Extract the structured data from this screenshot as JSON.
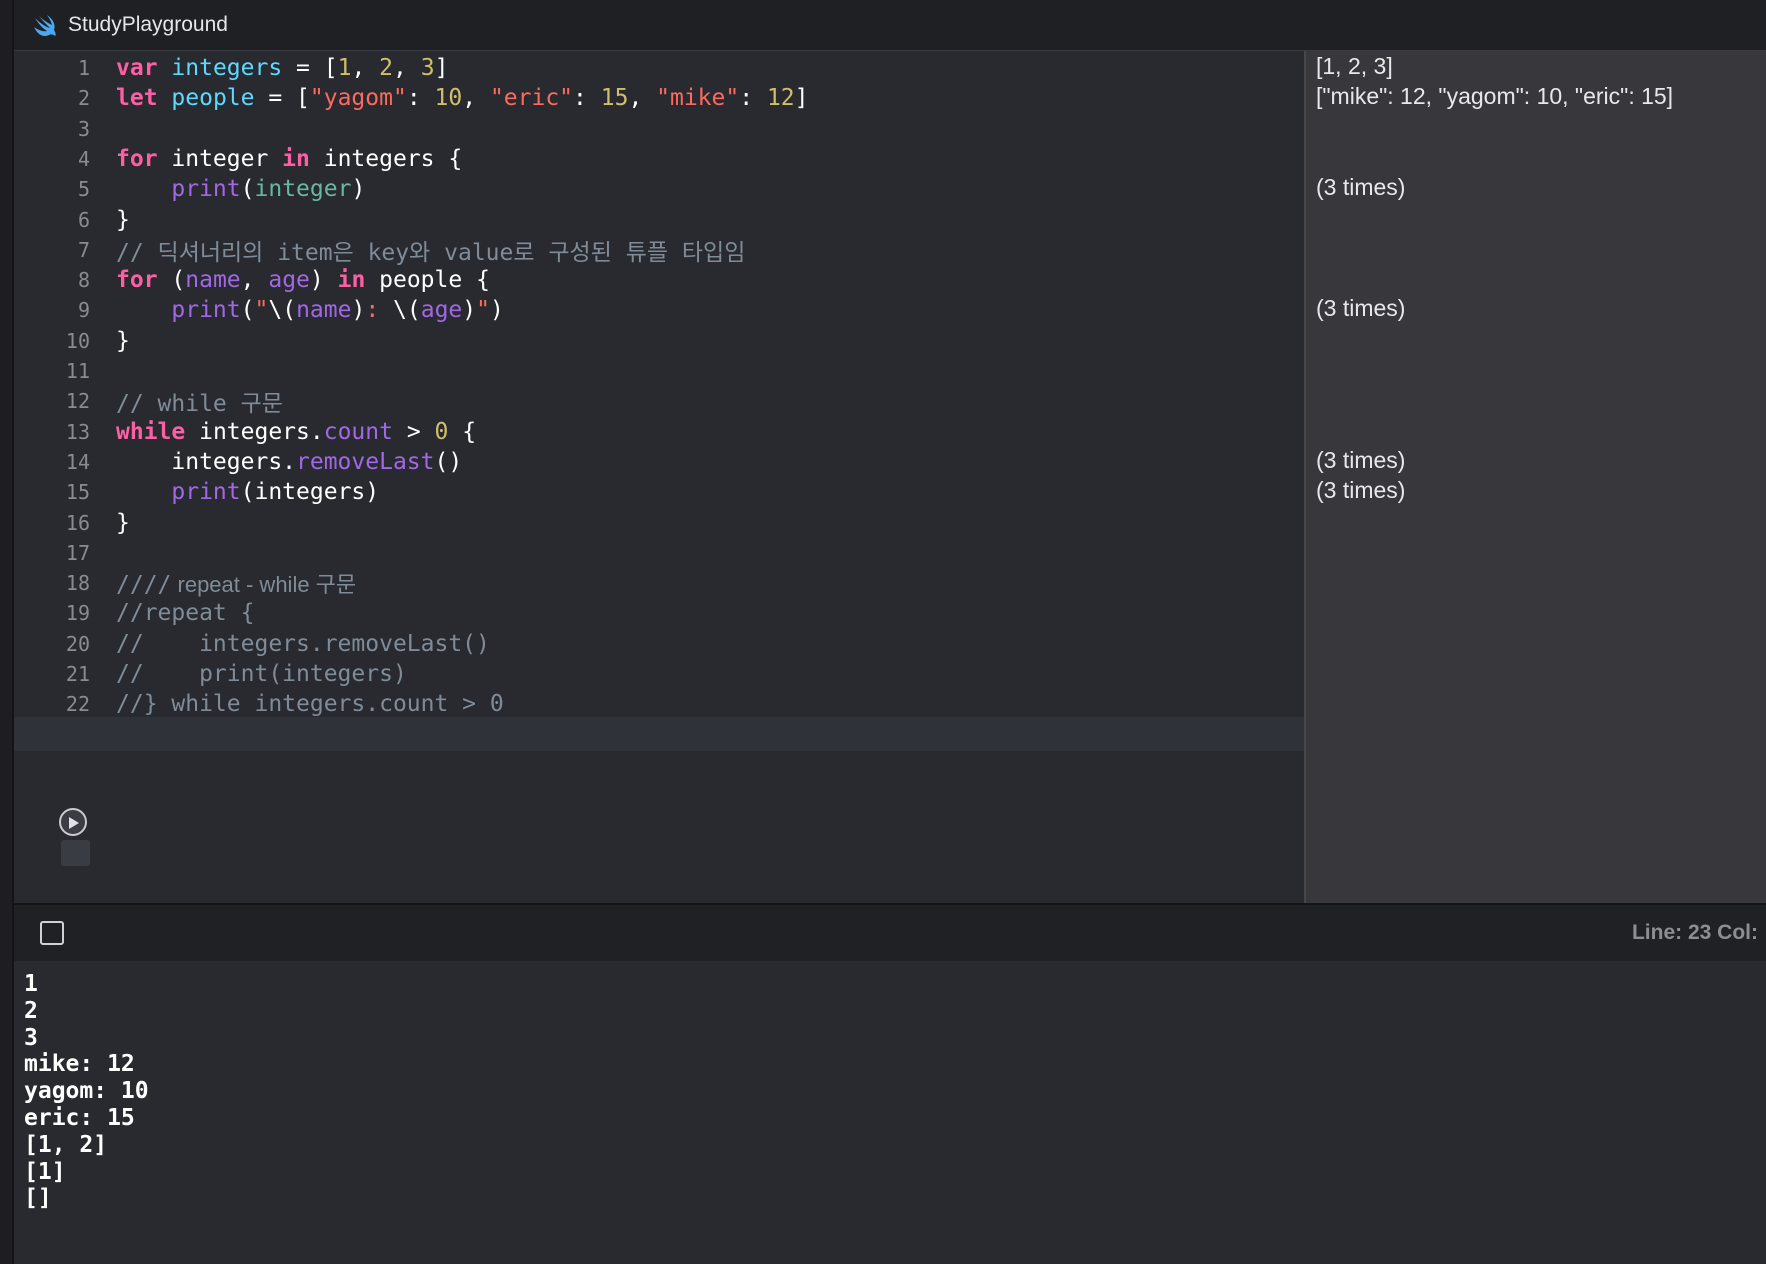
{
  "window": {
    "title": "StudyPlayground"
  },
  "editor": {
    "line_numbers": [
      "1",
      "2",
      "3",
      "4",
      "5",
      "6",
      "7",
      "8",
      "9",
      "10",
      "11",
      "12",
      "13",
      "14",
      "15",
      "16",
      "17",
      "18",
      "19",
      "20",
      "21",
      "22"
    ],
    "lines": [
      [
        {
          "t": "kw",
          "v": "var"
        },
        {
          "t": "p",
          "v": " "
        },
        {
          "t": "var",
          "v": "integers"
        },
        {
          "t": "p",
          "v": " = ["
        },
        {
          "t": "num",
          "v": "1"
        },
        {
          "t": "p",
          "v": ", "
        },
        {
          "t": "num",
          "v": "2"
        },
        {
          "t": "p",
          "v": ", "
        },
        {
          "t": "num",
          "v": "3"
        },
        {
          "t": "p",
          "v": "]"
        }
      ],
      [
        {
          "t": "kw",
          "v": "let"
        },
        {
          "t": "p",
          "v": " "
        },
        {
          "t": "var",
          "v": "people"
        },
        {
          "t": "p",
          "v": " = ["
        },
        {
          "t": "str",
          "v": "\"yagom\""
        },
        {
          "t": "p",
          "v": ": "
        },
        {
          "t": "num",
          "v": "10"
        },
        {
          "t": "p",
          "v": ", "
        },
        {
          "t": "str",
          "v": "\"eric\""
        },
        {
          "t": "p",
          "v": ": "
        },
        {
          "t": "num",
          "v": "15"
        },
        {
          "t": "p",
          "v": ", "
        },
        {
          "t": "str",
          "v": "\"mike\""
        },
        {
          "t": "p",
          "v": ": "
        },
        {
          "t": "num",
          "v": "12"
        },
        {
          "t": "p",
          "v": "]"
        }
      ],
      [],
      [
        {
          "t": "kw",
          "v": "for"
        },
        {
          "t": "p",
          "v": " integer "
        },
        {
          "t": "kw",
          "v": "in"
        },
        {
          "t": "p",
          "v": " integers {"
        }
      ],
      [
        {
          "t": "p",
          "v": "    "
        },
        {
          "t": "fn",
          "v": "print"
        },
        {
          "t": "p",
          "v": "("
        },
        {
          "t": "ident",
          "v": "integer"
        },
        {
          "t": "p",
          "v": ")"
        }
      ],
      [
        {
          "t": "p",
          "v": "}"
        }
      ],
      [
        {
          "t": "cm",
          "v": "// 딕셔너리의 item은 key와 value로 구성된 튜플 타입임"
        }
      ],
      [
        {
          "t": "kw",
          "v": "for"
        },
        {
          "t": "p",
          "v": " ("
        },
        {
          "t": "fn",
          "v": "name"
        },
        {
          "t": "p",
          "v": ", "
        },
        {
          "t": "fn",
          "v": "age"
        },
        {
          "t": "p",
          "v": ") "
        },
        {
          "t": "kw",
          "v": "in"
        },
        {
          "t": "p",
          "v": " people {"
        }
      ],
      [
        {
          "t": "p",
          "v": "    "
        },
        {
          "t": "fn",
          "v": "print"
        },
        {
          "t": "p",
          "v": "("
        },
        {
          "t": "str",
          "v": "\""
        },
        {
          "t": "p",
          "v": "\\("
        },
        {
          "t": "fn",
          "v": "name"
        },
        {
          "t": "p",
          "v": ")"
        },
        {
          "t": "str",
          "v": ": "
        },
        {
          "t": "p",
          "v": "\\("
        },
        {
          "t": "fn",
          "v": "age"
        },
        {
          "t": "p",
          "v": ")"
        },
        {
          "t": "str",
          "v": "\""
        },
        {
          "t": "p",
          "v": ")"
        }
      ],
      [
        {
          "t": "p",
          "v": "}"
        }
      ],
      [],
      [
        {
          "t": "cm",
          "v": "// while 구문"
        }
      ],
      [
        {
          "t": "kw",
          "v": "while"
        },
        {
          "t": "p",
          "v": " integers."
        },
        {
          "t": "prop",
          "v": "count"
        },
        {
          "t": "p",
          "v": " > "
        },
        {
          "t": "num",
          "v": "0"
        },
        {
          "t": "p",
          "v": " {"
        }
      ],
      [
        {
          "t": "p",
          "v": "    integers."
        },
        {
          "t": "fn",
          "v": "removeLast"
        },
        {
          "t": "p",
          "v": "()"
        }
      ],
      [
        {
          "t": "p",
          "v": "    "
        },
        {
          "t": "fn",
          "v": "print"
        },
        {
          "t": "p",
          "v": "(integers)"
        }
      ],
      [
        {
          "t": "p",
          "v": "}"
        }
      ],
      [],
      [
        {
          "t": "cm",
          "v": "////"
        },
        {
          "t": "cm-prop",
          "v": " repeat - while 구문"
        }
      ],
      [
        {
          "t": "cm",
          "v": "//repeat {"
        }
      ],
      [
        {
          "t": "cm",
          "v": "//    integers.removeLast()"
        }
      ],
      [
        {
          "t": "cm",
          "v": "//    print(integers)"
        }
      ],
      [
        {
          "t": "cm",
          "v": "//} while integers.count > 0"
        }
      ]
    ]
  },
  "results": [
    {
      "line": 1,
      "text": "[1, 2, 3]"
    },
    {
      "line": 2,
      "text": "[\"mike\": 12, \"yagom\": 10, \"eric\": 15]"
    },
    {
      "line": 5,
      "text": "(3 times)"
    },
    {
      "line": 9,
      "text": "(3 times)"
    },
    {
      "line": 14,
      "text": "(3 times)"
    },
    {
      "line": 15,
      "text": "(3 times)"
    }
  ],
  "status": {
    "text": "Line: 23  Col:"
  },
  "console": {
    "lines": [
      "1",
      "2",
      "3",
      "mike: 12",
      "yagom: 10",
      "eric: 15",
      "[1, 2]",
      "[1]",
      "[]"
    ]
  }
}
